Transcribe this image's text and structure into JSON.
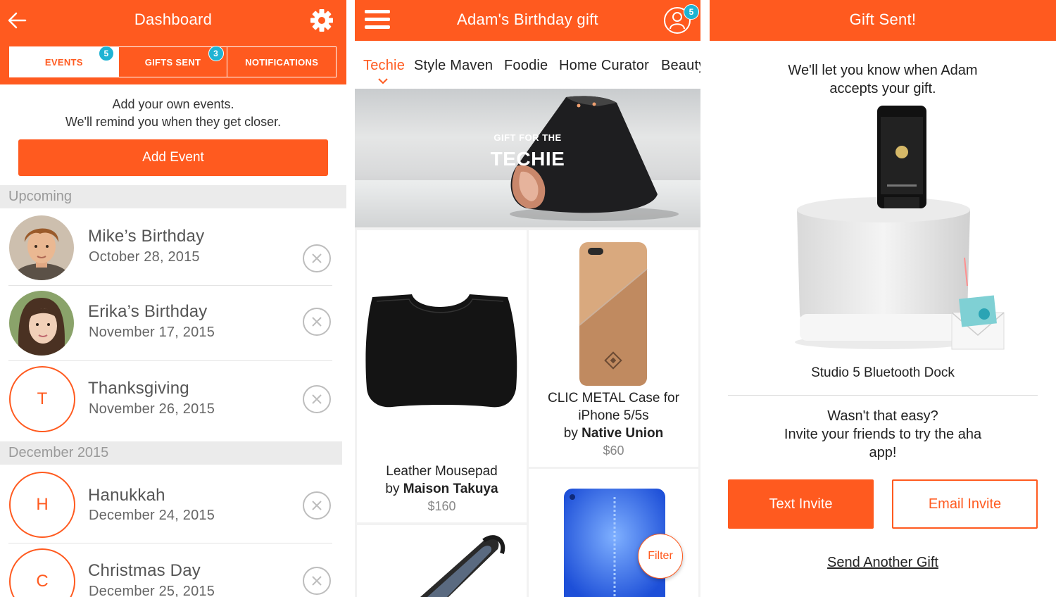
{
  "colors": {
    "accent": "#ff5a1f",
    "badge": "#1fb3d3"
  },
  "dashboard": {
    "title": "Dashboard",
    "tabs": [
      {
        "label": "EVENTS",
        "badge": "5"
      },
      {
        "label": "GIFTS SENT",
        "badge": "3"
      },
      {
        "label": "NOTIFICATIONS"
      }
    ],
    "intro_line1": "Add your own events.",
    "intro_line2": "We'll remind you when they get closer.",
    "add_event_label": "Add Event",
    "sections": [
      {
        "header": "Upcoming",
        "events": [
          {
            "name": "Mike’s Birthday",
            "date": "October 28, 2015"
          },
          {
            "name": "Erika’s Birthday",
            "date": "November 17, 2015"
          },
          {
            "name": "Thanksgiving",
            "date": "November 26, 2015",
            "initial": "T"
          }
        ]
      },
      {
        "header": "December 2015",
        "events": [
          {
            "name": "Hanukkah",
            "date": "December 24, 2015",
            "initial": "H"
          },
          {
            "name": "Christmas Day",
            "date": "December 25, 2015",
            "initial": "C"
          }
        ]
      }
    ]
  },
  "shop": {
    "title": "Adam's Birthday gift",
    "profile_badge": "5",
    "categories": [
      "Techie",
      "Style Maven",
      "Foodie",
      "Home Curator",
      "Beauty"
    ],
    "hero_small": "GIFT FOR THE",
    "hero_big": "TECHIE",
    "products": [
      {
        "name_line1": "Leather Mousepad",
        "by": "by ",
        "brand": "Maison Takuya",
        "price": "$160"
      },
      {
        "name_line1": "CLIC METAL  Case for",
        "name_line2": "iPhone 5/5s",
        "by": "by ",
        "brand": "Native Union",
        "price": "$60"
      }
    ],
    "filter_label": "Filter"
  },
  "sent": {
    "title": "Gift Sent!",
    "msg_line1": "We'll let you know when Adam",
    "msg_line2": "accepts your gift.",
    "product_name": "Studio 5 Bluetooth Dock",
    "invite_line1": "Wasn't that easy?",
    "invite_line2": "Invite your friends to try the aha",
    "invite_line3": "app!",
    "text_invite_label": "Text Invite",
    "email_invite_label": "Email Invite",
    "send_another_label": "Send Another Gift"
  }
}
